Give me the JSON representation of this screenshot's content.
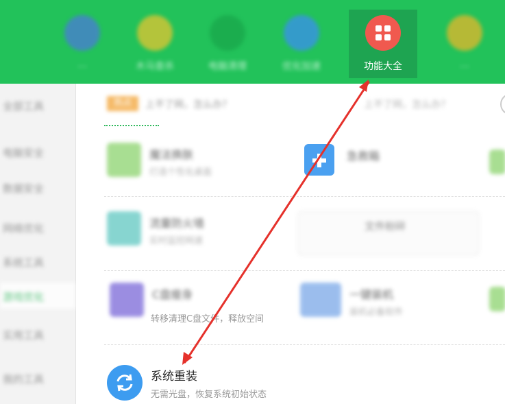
{
  "topbar": {
    "nav": [
      {
        "label": "…",
        "icon": "blue-circle-icon",
        "color": "#4a7bd8"
      },
      {
        "label": "木马查杀",
        "icon": "yellow-circle-icon",
        "color": "#e5c531"
      },
      {
        "label": "电脑清理",
        "icon": "green-circle-icon",
        "color": "#19a74b"
      },
      {
        "label": "系统修复",
        "icon": "teal-circle-icon",
        "color": "#27a56a"
      },
      {
        "label": "优化加速",
        "icon": "blue-rocket-icon",
        "color": "#3b8ff0"
      },
      {
        "label": "功能大全",
        "icon": "grid-icon",
        "color": "#f0594f",
        "active": true
      },
      {
        "label": "…",
        "icon": "yellow-circle-icon",
        "color": "#e8b72a"
      }
    ]
  },
  "sidebar": {
    "items": [
      {
        "label": "全部工具"
      },
      {
        "label": "电脑安全"
      },
      {
        "label": "数据安全"
      },
      {
        "label": "网络优化"
      },
      {
        "label": "系统工具"
      },
      {
        "label": "游戏优化",
        "selected": true
      },
      {
        "label": "实用工具"
      },
      {
        "label": "我的工具"
      }
    ]
  },
  "notice": {
    "badge": "热点",
    "text": "上不了网，怎么办？",
    "question": "上不了网，怎么办？"
  },
  "tools": {
    "row1": [
      {
        "title": "魔法换肤",
        "desc": "打造个性化桌面",
        "icon": "magic-wand-icon"
      },
      {
        "title": "急救箱",
        "desc": "",
        "icon": "first-aid-kit-icon"
      }
    ],
    "row2": [
      {
        "title": "流量防火墙",
        "desc": "实时监控网速",
        "icon": "flow-icon"
      },
      {
        "title": "文件粉碎",
        "desc": "",
        "icon": "shredder-icon"
      }
    ],
    "row3": [
      {
        "title": "C盘瘦身",
        "desc": "转移清理C盘文件，释放空间",
        "icon": "c-drive-icon"
      },
      {
        "title": "一键装机",
        "desc": "装机必备软件",
        "icon": "monitor-icon"
      }
    ],
    "featured": {
      "title": "系统重装",
      "desc": "无需光盘，恢复系统初始状态",
      "icon": "refresh-icon"
    }
  },
  "colors": {
    "top_bar": "#22c25a",
    "accent_red": "#f0594f",
    "arrow_red": "#e5312b",
    "reinstall_blue": "#3d9cf0"
  }
}
